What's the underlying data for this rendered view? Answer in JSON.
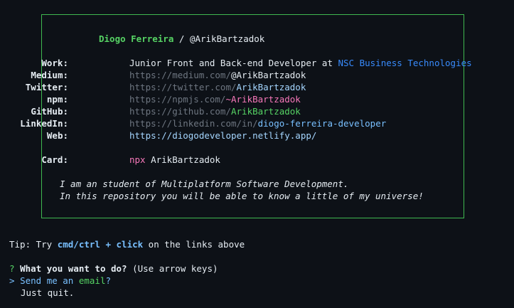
{
  "card": {
    "name": "Diogo Ferreira",
    "separator": " / ",
    "handle": "@ArikBartzadok",
    "rows": [
      {
        "label": "Work:",
        "prefix": "Junior Front and Back-end Developer at ",
        "value": "NSC Business Technologies"
      },
      {
        "label": "Medium:",
        "prefix": "https://medium.com/",
        "value": "@ArikBartzadok"
      },
      {
        "label": "Twitter:",
        "prefix": "https://twitter.com/",
        "value": "ArikBartzadok"
      },
      {
        "label": "npm:",
        "prefix": "https://npmjs.com/",
        "value": "~ArikBartzadok"
      },
      {
        "label": "GitHub:",
        "prefix": "https://github.com/",
        "value": "ArikBartzadok"
      },
      {
        "label": "LinkedIn:",
        "prefix": "https://linkedin.com/in/",
        "value": "diogo-ferreira-developer"
      },
      {
        "label": "Web:",
        "prefix": "",
        "value": "https://diogodeveloper.netlify.app/"
      }
    ],
    "card_row": {
      "label": "Card:",
      "cmd": "npx",
      "value": " ArikBartzadok"
    },
    "bio": [
      "I am an student of Multiplatform Software Development.",
      "In this repository you will be able to know a little of my universe!"
    ]
  },
  "tip": {
    "prefix": "Tip: Try ",
    "keys": "cmd/ctrl + click",
    "suffix": " on the links above"
  },
  "prompt": {
    "marker": "?",
    "question": "What you want to do?",
    "hint": " (Use arrow keys)",
    "pointer": ">",
    "options": [
      {
        "pre": "Send me an ",
        "accent": "email",
        "post": "?"
      },
      {
        "pre": "Just quit.",
        "accent": "",
        "post": ""
      }
    ]
  },
  "colors": {
    "border": "#3fb950",
    "name": "#56d364",
    "accent": "#79c0ff",
    "link_muted": "#6e7681",
    "npm": "#f778ba",
    "company": "#388bfd"
  }
}
